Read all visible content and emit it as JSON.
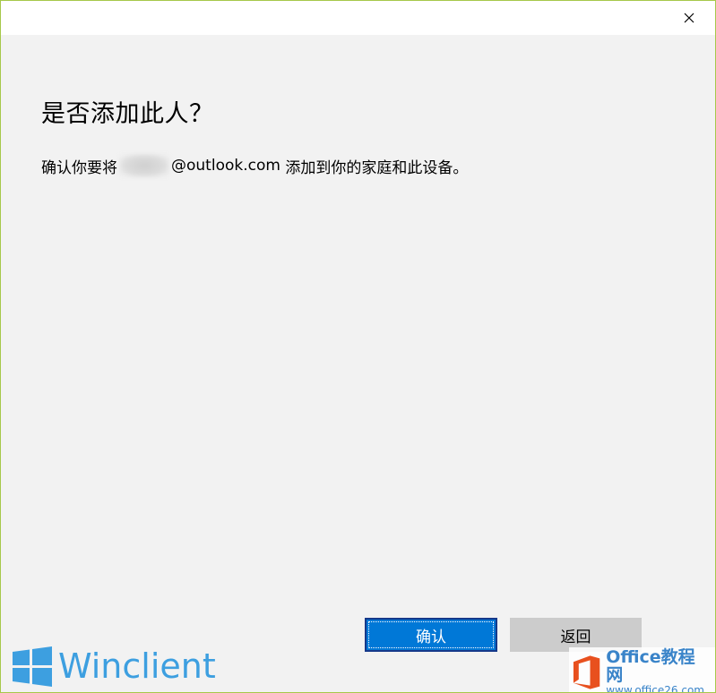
{
  "dialog": {
    "title": "是否添加此人？",
    "message_prefix": "确认你要将",
    "message_email": "@outlook.com",
    "message_suffix": " 添加到你的家庭和此设备。"
  },
  "buttons": {
    "confirm_label": "确认",
    "back_label": "返回"
  },
  "watermarks": {
    "left_text": "Winclient",
    "right_brand": "Office教程网",
    "right_url": "www.office26.com"
  },
  "icons": {
    "close": "close-icon",
    "windows_logo": "windows-logo-icon",
    "office_logo": "office-logo-icon"
  },
  "colors": {
    "accent": "#0078d7",
    "dialog_background": "#f2f2f2",
    "secondary_button": "#cccccc",
    "window_border": "#a6c84a",
    "watermark_blue": "#3d9fe0",
    "office_orange": "#e8501e"
  }
}
